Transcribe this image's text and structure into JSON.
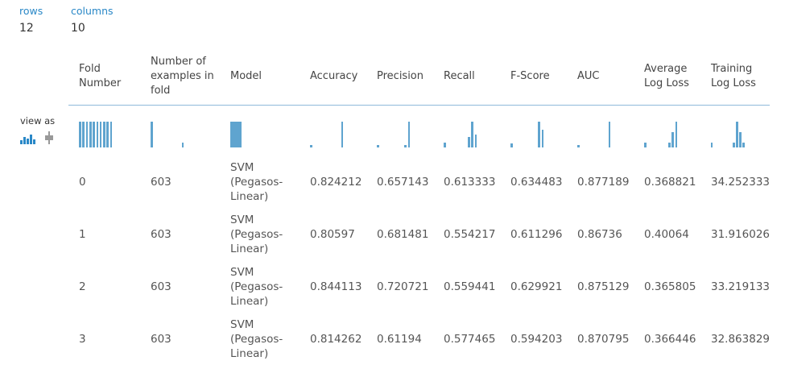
{
  "stats": {
    "rows_label": "rows",
    "rows_value": "12",
    "columns_label": "columns",
    "columns_value": "10"
  },
  "view_as": {
    "label": "view as",
    "options": [
      "histogram-icon",
      "boxplot-icon"
    ]
  },
  "table": {
    "headers": [
      "Fold Number",
      "Number of examples in fold",
      "Model",
      "Accuracy",
      "Precision",
      "Recall",
      "F-Score",
      "AUC",
      "Average Log Loss",
      "Training Log Loss"
    ],
    "rows": [
      [
        "0",
        "603",
        "SVM (Pegasos-Linear)",
        "0.824212",
        "0.657143",
        "0.613333",
        "0.634483",
        "0.877189",
        "0.368821",
        "34.252333"
      ],
      [
        "1",
        "603",
        "SVM (Pegasos-Linear)",
        "0.80597",
        "0.681481",
        "0.554217",
        "0.611296",
        "0.86736",
        "0.40064",
        "31.916026"
      ],
      [
        "2",
        "603",
        "SVM (Pegasos-Linear)",
        "0.844113",
        "0.720721",
        "0.559441",
        "0.629921",
        "0.875129",
        "0.365805",
        "33.219133"
      ],
      [
        "3",
        "603",
        "SVM (Pegasos-Linear)",
        "0.814262",
        "0.61194",
        "0.577465",
        "0.594203",
        "0.870795",
        "0.366446",
        "32.863829"
      ]
    ],
    "histograms": [
      [
        1,
        1,
        1,
        1,
        1,
        1,
        1,
        1,
        1,
        1
      ],
      [
        1,
        0,
        0,
        0,
        0,
        0,
        0,
        0,
        0,
        0.2
      ],
      [
        1
      ],
      [
        0.1,
        0,
        0,
        0,
        0,
        0,
        0,
        0,
        0,
        1
      ],
      [
        0.1,
        0,
        0,
        0,
        0,
        0,
        0,
        0,
        0.1,
        1
      ],
      [
        0.2,
        0,
        0,
        0,
        0,
        0,
        0,
        0.4,
        1,
        0.5
      ],
      [
        0.15,
        0,
        0,
        0,
        0,
        0,
        0,
        0,
        1,
        0.7
      ],
      [
        0.1,
        0,
        0,
        0,
        0,
        0,
        0,
        0,
        0,
        1
      ],
      [
        0.2,
        0,
        0,
        0,
        0,
        0,
        0,
        0.2,
        0.6,
        1
      ],
      [
        0.2,
        0,
        0,
        0,
        0,
        0,
        0,
        0.2,
        1,
        0.6,
        0.2
      ]
    ],
    "bar_color": "#5fa4cf"
  }
}
